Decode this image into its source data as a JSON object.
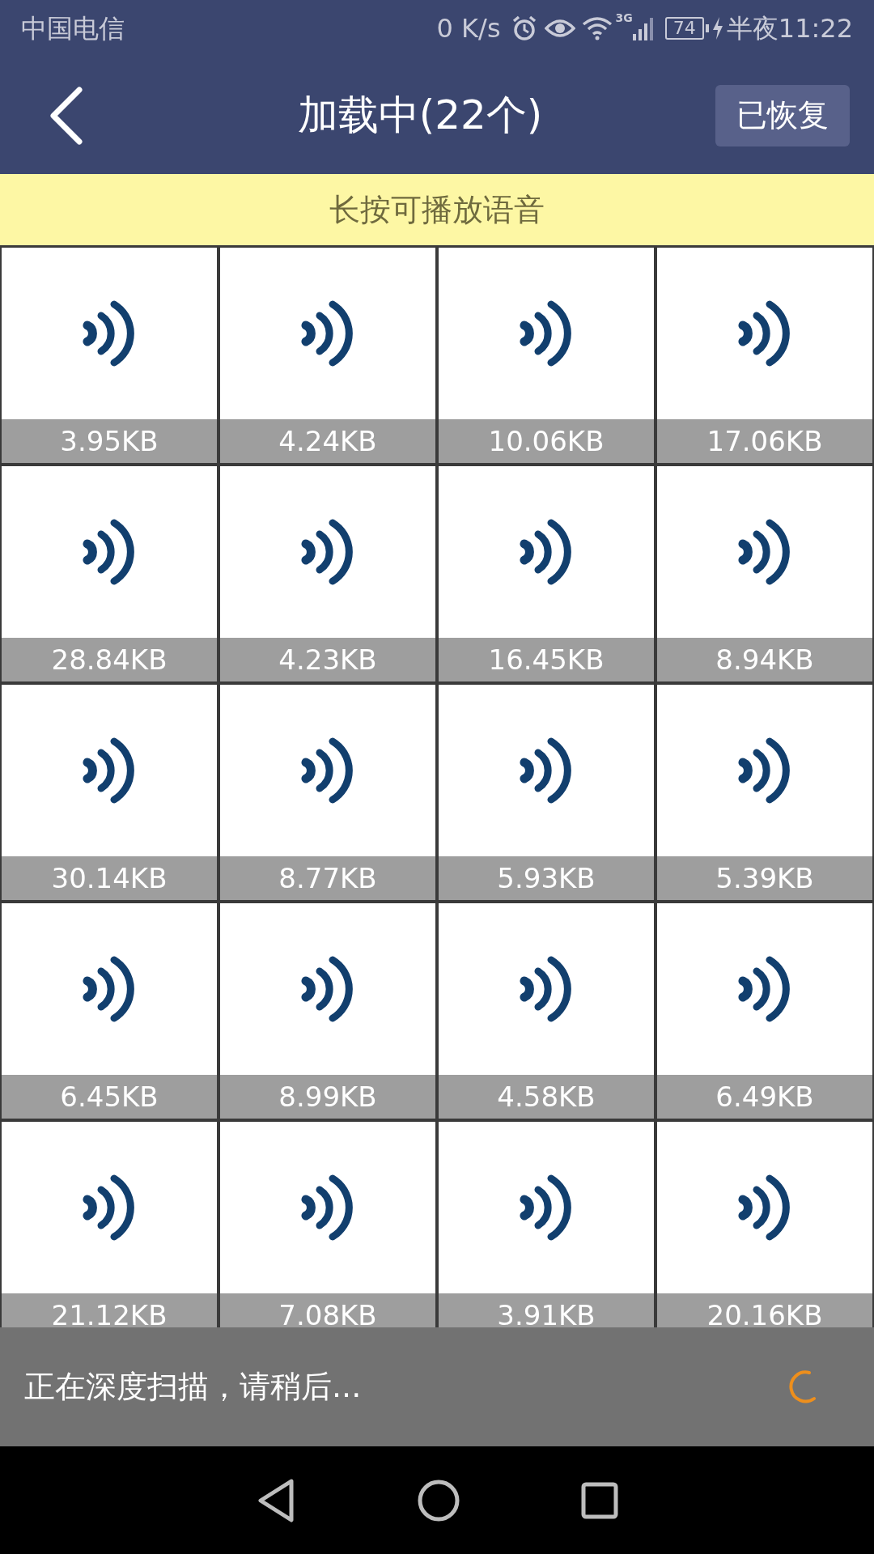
{
  "status_bar": {
    "carrier": "中国电信",
    "speed": "0 K/s",
    "network": "3G",
    "battery": "74",
    "charging": true,
    "time": "半夜11:22"
  },
  "header": {
    "title": "加载中(22个)",
    "action": "已恢复"
  },
  "banner": "长按可播放语音",
  "files": [
    {
      "size": "3.95KB"
    },
    {
      "size": "4.24KB"
    },
    {
      "size": "10.06KB"
    },
    {
      "size": "17.06KB"
    },
    {
      "size": "28.84KB"
    },
    {
      "size": "4.23KB"
    },
    {
      "size": "16.45KB"
    },
    {
      "size": "8.94KB"
    },
    {
      "size": "30.14KB"
    },
    {
      "size": "8.77KB"
    },
    {
      "size": "5.93KB"
    },
    {
      "size": "5.39KB"
    },
    {
      "size": "6.45KB"
    },
    {
      "size": "8.99KB"
    },
    {
      "size": "4.58KB"
    },
    {
      "size": "6.49KB"
    },
    {
      "size": "21.12KB"
    },
    {
      "size": "7.08KB"
    },
    {
      "size": "3.91KB"
    },
    {
      "size": "20.16KB"
    }
  ],
  "scan_toast": {
    "message": "正在深度扫描，请稍后..."
  }
}
